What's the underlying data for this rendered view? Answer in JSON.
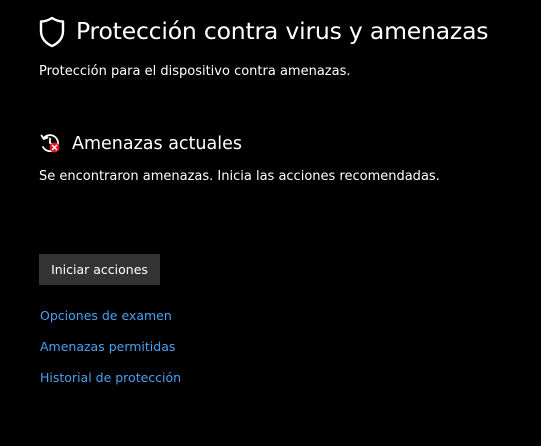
{
  "header": {
    "title": "Protección contra virus y amenazas",
    "subtitle": "Protección para el dispositivo contra amenazas.",
    "icon": "shield-icon"
  },
  "current_threats": {
    "title": "Amenazas actuales",
    "description": "Se encontraron amenazas. Inicia las acciones recomendadas.",
    "icon": "threat-warning-icon",
    "icon_color": "#e81123",
    "action_button": "Iniciar acciones"
  },
  "links": [
    {
      "label": "Opciones de examen"
    },
    {
      "label": "Amenazas permitidas"
    },
    {
      "label": "Historial de protección"
    }
  ],
  "colors": {
    "background": "#000000",
    "text": "#ffffff",
    "link": "#4aa0ef",
    "button": "#333333"
  }
}
